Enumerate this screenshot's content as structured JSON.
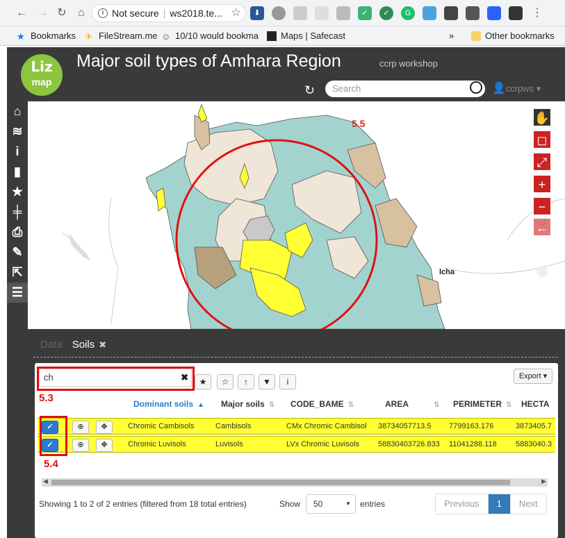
{
  "browser": {
    "security_label": "Not secure",
    "url": "ws2018.te...",
    "bookmarks": [
      "Bookmarks",
      "FileStream.me",
      "10/10 would bookma",
      "Maps | Safecast",
      "»",
      "Other bookmarks"
    ]
  },
  "app": {
    "title": "Major soil types of Amhara Region",
    "subtitle": "ccrp workshop",
    "search_placeholder": "Search",
    "user": "ccrpws"
  },
  "map": {
    "place_label": "lcha",
    "annotation": "5.5"
  },
  "dock": {
    "tabs": [
      "Data",
      "Soils"
    ]
  },
  "table": {
    "filter_value": "ch",
    "export_label": "Export",
    "columns": [
      "Dominant soils",
      "Major soils",
      "CODE_BAME",
      "AREA",
      "PERIMETER",
      "HECTA"
    ],
    "rows": [
      [
        "Chromic Cambisols",
        "Cambisols",
        "CMx Chromic Cambisol",
        "38734057713.5",
        "7799163.176",
        "3873405.7"
      ],
      [
        "Chromic Luvisols",
        "Luvisols",
        "LVx Chromic Luvisols",
        "58830403726.833",
        "11041288.118",
        "5883040.3"
      ]
    ],
    "info": "Showing 1 to 2 of 2 entries (filtered from 18 total entries)",
    "show_label": "Show",
    "page_size": "50",
    "entries_label": "entries",
    "pager": {
      "prev": "Previous",
      "current": "1",
      "next": "Next"
    }
  },
  "annotations": {
    "filter": "5.3",
    "select": "5.4"
  },
  "colors": {
    "highlight": "#ffff33",
    "annotation_red": "#e01010",
    "header_bg": "#3a3a3a"
  }
}
